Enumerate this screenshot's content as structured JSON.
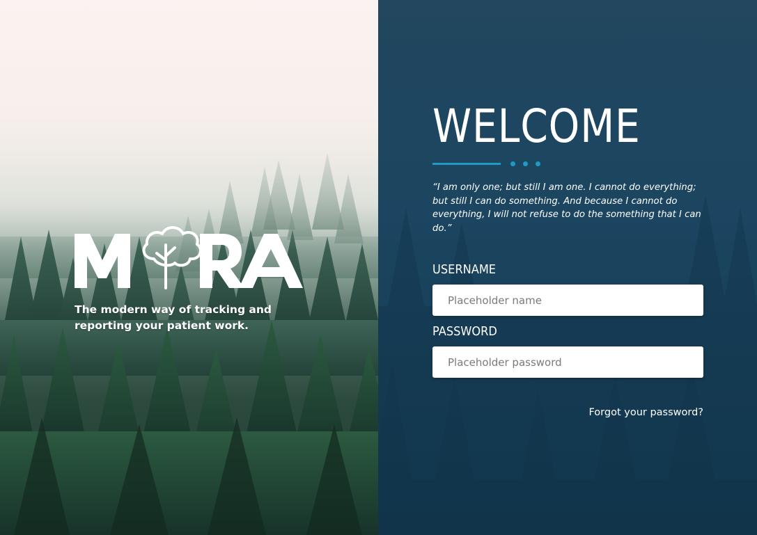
{
  "brand": {
    "logo_text": "MORA",
    "tagline": "The modern way of tracking and reporting your patient work."
  },
  "login": {
    "title": "WELCOME",
    "quote": "“I am only one; but still I am one. I cannot do everything; but still I can do something. And because I cannot do everything, I will not refuse to do the something that I can do.”",
    "username_label": "USERNAME",
    "username_placeholder": "Placeholder name",
    "password_label": "PASSWORD",
    "password_placeholder": "Placeholder password",
    "forgot_link": "Forgot your password?"
  },
  "colors": {
    "accent": "#1e9ac4",
    "panel_bg": "#1b4560",
    "text": "#ffffff"
  },
  "icons": [
    "tree-icon"
  ]
}
